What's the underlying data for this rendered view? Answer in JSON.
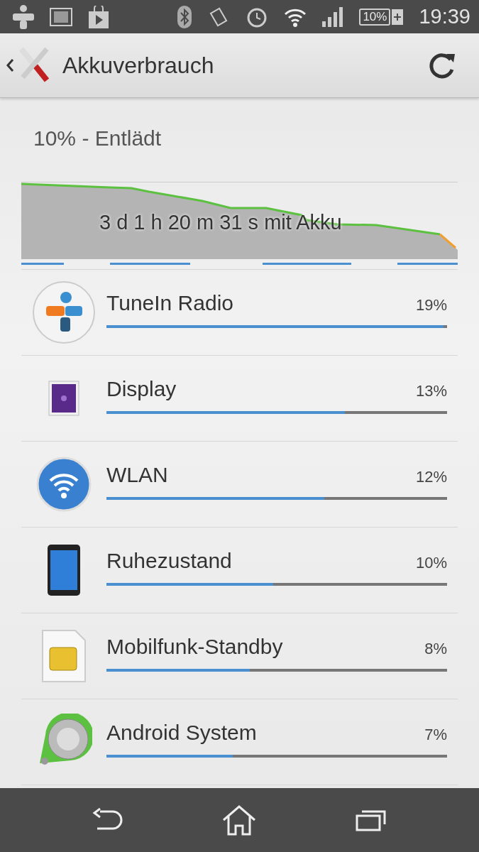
{
  "status_bar": {
    "battery": "10%",
    "time": "19:39"
  },
  "action_bar": {
    "title": "Akkuverbrauch"
  },
  "summary": "10% - Entlädt",
  "graph": {
    "caption": "3 d 1 h 20 m 31 s mit Akku"
  },
  "apps": [
    {
      "kind": "tunein",
      "name": "TuneIn Radio",
      "percent": "19%",
      "level": 0.99
    },
    {
      "kind": "display",
      "name": "Display",
      "percent": "13%",
      "level": 0.7
    },
    {
      "kind": "wlan",
      "name": "WLAN",
      "percent": "12%",
      "level": 0.64
    },
    {
      "kind": "phone",
      "name": "Ruhezustand",
      "percent": "10%",
      "level": 0.49
    },
    {
      "kind": "sim",
      "name": "Mobilfunk-Standby",
      "percent": "8%",
      "level": 0.42
    },
    {
      "kind": "system",
      "name": "Android System",
      "percent": "7%",
      "level": 0.37
    }
  ]
}
